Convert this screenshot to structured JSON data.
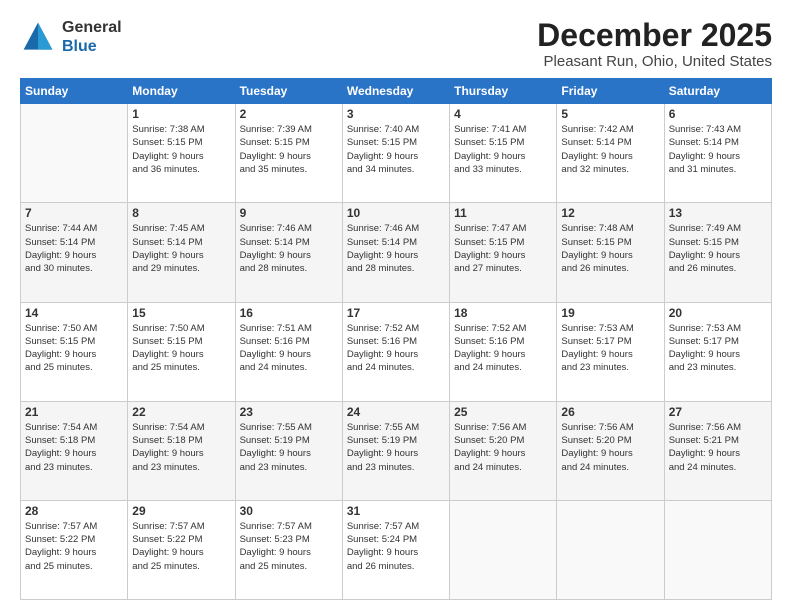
{
  "header": {
    "logo": {
      "line1": "General",
      "line2": "Blue"
    },
    "title": "December 2025",
    "location": "Pleasant Run, Ohio, United States"
  },
  "calendar": {
    "days_of_week": [
      "Sunday",
      "Monday",
      "Tuesday",
      "Wednesday",
      "Thursday",
      "Friday",
      "Saturday"
    ],
    "weeks": [
      [
        {
          "day": "",
          "info": ""
        },
        {
          "day": "1",
          "info": "Sunrise: 7:38 AM\nSunset: 5:15 PM\nDaylight: 9 hours\nand 36 minutes."
        },
        {
          "day": "2",
          "info": "Sunrise: 7:39 AM\nSunset: 5:15 PM\nDaylight: 9 hours\nand 35 minutes."
        },
        {
          "day": "3",
          "info": "Sunrise: 7:40 AM\nSunset: 5:15 PM\nDaylight: 9 hours\nand 34 minutes."
        },
        {
          "day": "4",
          "info": "Sunrise: 7:41 AM\nSunset: 5:15 PM\nDaylight: 9 hours\nand 33 minutes."
        },
        {
          "day": "5",
          "info": "Sunrise: 7:42 AM\nSunset: 5:14 PM\nDaylight: 9 hours\nand 32 minutes."
        },
        {
          "day": "6",
          "info": "Sunrise: 7:43 AM\nSunset: 5:14 PM\nDaylight: 9 hours\nand 31 minutes."
        }
      ],
      [
        {
          "day": "7",
          "info": "Sunrise: 7:44 AM\nSunset: 5:14 PM\nDaylight: 9 hours\nand 30 minutes."
        },
        {
          "day": "8",
          "info": "Sunrise: 7:45 AM\nSunset: 5:14 PM\nDaylight: 9 hours\nand 29 minutes."
        },
        {
          "day": "9",
          "info": "Sunrise: 7:46 AM\nSunset: 5:14 PM\nDaylight: 9 hours\nand 28 minutes."
        },
        {
          "day": "10",
          "info": "Sunrise: 7:46 AM\nSunset: 5:14 PM\nDaylight: 9 hours\nand 28 minutes."
        },
        {
          "day": "11",
          "info": "Sunrise: 7:47 AM\nSunset: 5:15 PM\nDaylight: 9 hours\nand 27 minutes."
        },
        {
          "day": "12",
          "info": "Sunrise: 7:48 AM\nSunset: 5:15 PM\nDaylight: 9 hours\nand 26 minutes."
        },
        {
          "day": "13",
          "info": "Sunrise: 7:49 AM\nSunset: 5:15 PM\nDaylight: 9 hours\nand 26 minutes."
        }
      ],
      [
        {
          "day": "14",
          "info": "Sunrise: 7:50 AM\nSunset: 5:15 PM\nDaylight: 9 hours\nand 25 minutes."
        },
        {
          "day": "15",
          "info": "Sunrise: 7:50 AM\nSunset: 5:15 PM\nDaylight: 9 hours\nand 25 minutes."
        },
        {
          "day": "16",
          "info": "Sunrise: 7:51 AM\nSunset: 5:16 PM\nDaylight: 9 hours\nand 24 minutes."
        },
        {
          "day": "17",
          "info": "Sunrise: 7:52 AM\nSunset: 5:16 PM\nDaylight: 9 hours\nand 24 minutes."
        },
        {
          "day": "18",
          "info": "Sunrise: 7:52 AM\nSunset: 5:16 PM\nDaylight: 9 hours\nand 24 minutes."
        },
        {
          "day": "19",
          "info": "Sunrise: 7:53 AM\nSunset: 5:17 PM\nDaylight: 9 hours\nand 23 minutes."
        },
        {
          "day": "20",
          "info": "Sunrise: 7:53 AM\nSunset: 5:17 PM\nDaylight: 9 hours\nand 23 minutes."
        }
      ],
      [
        {
          "day": "21",
          "info": "Sunrise: 7:54 AM\nSunset: 5:18 PM\nDaylight: 9 hours\nand 23 minutes."
        },
        {
          "day": "22",
          "info": "Sunrise: 7:54 AM\nSunset: 5:18 PM\nDaylight: 9 hours\nand 23 minutes."
        },
        {
          "day": "23",
          "info": "Sunrise: 7:55 AM\nSunset: 5:19 PM\nDaylight: 9 hours\nand 23 minutes."
        },
        {
          "day": "24",
          "info": "Sunrise: 7:55 AM\nSunset: 5:19 PM\nDaylight: 9 hours\nand 23 minutes."
        },
        {
          "day": "25",
          "info": "Sunrise: 7:56 AM\nSunset: 5:20 PM\nDaylight: 9 hours\nand 24 minutes."
        },
        {
          "day": "26",
          "info": "Sunrise: 7:56 AM\nSunset: 5:20 PM\nDaylight: 9 hours\nand 24 minutes."
        },
        {
          "day": "27",
          "info": "Sunrise: 7:56 AM\nSunset: 5:21 PM\nDaylight: 9 hours\nand 24 minutes."
        }
      ],
      [
        {
          "day": "28",
          "info": "Sunrise: 7:57 AM\nSunset: 5:22 PM\nDaylight: 9 hours\nand 25 minutes."
        },
        {
          "day": "29",
          "info": "Sunrise: 7:57 AM\nSunset: 5:22 PM\nDaylight: 9 hours\nand 25 minutes."
        },
        {
          "day": "30",
          "info": "Sunrise: 7:57 AM\nSunset: 5:23 PM\nDaylight: 9 hours\nand 25 minutes."
        },
        {
          "day": "31",
          "info": "Sunrise: 7:57 AM\nSunset: 5:24 PM\nDaylight: 9 hours\nand 26 minutes."
        },
        {
          "day": "",
          "info": ""
        },
        {
          "day": "",
          "info": ""
        },
        {
          "day": "",
          "info": ""
        }
      ]
    ]
  }
}
